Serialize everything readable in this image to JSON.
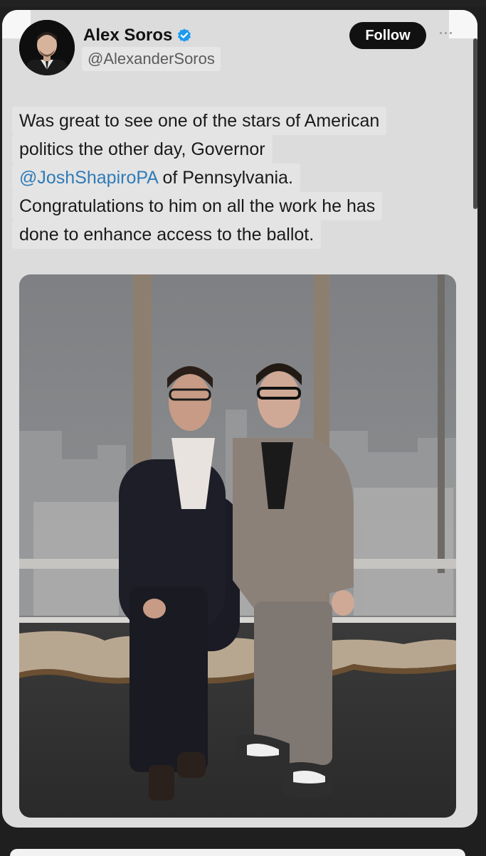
{
  "tweet": {
    "author_name": "Alex Soros",
    "author_handle": "@AlexanderSoros",
    "follow_label": "Follow",
    "text_lines": [
      "Was great to see one of the stars of American",
      "politics the other day, Governor",
      "of Pennsylvania.",
      "Congratulations to him on all the work he has",
      "done to enhance access to the ballot."
    ],
    "mention": "@JoshShapiroPA"
  },
  "icons": {
    "verified": "verified-badge-icon",
    "more": "more-options-icon"
  },
  "colors": {
    "accent": "#1d9bf0",
    "mention": "#2e7bb8",
    "follow_bg": "#111111"
  }
}
